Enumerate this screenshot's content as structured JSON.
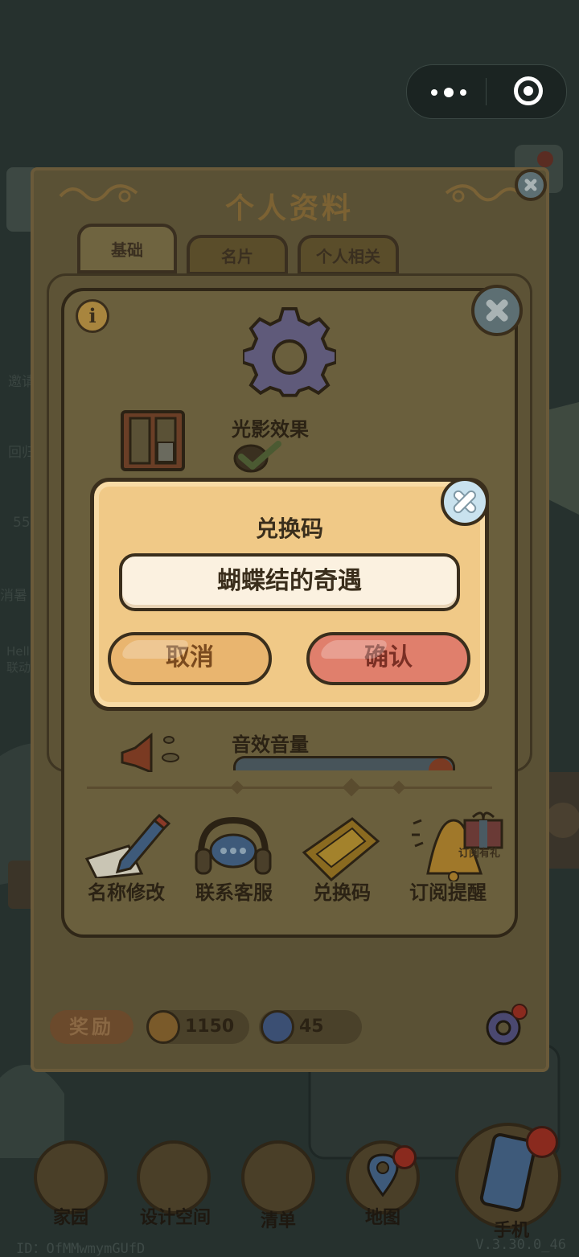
{
  "capsule": {
    "more": "more-icon",
    "close": "target-icon"
  },
  "profile_panel": {
    "title": "个人资料",
    "tabs": [
      {
        "label": "基础",
        "active": true
      },
      {
        "label": "名片",
        "active": false
      },
      {
        "label": "个人相关",
        "active": false
      }
    ]
  },
  "settings": {
    "light_effect_label": "光影效果",
    "light_effect_enabled": true,
    "sound_volume_label": "音效音量"
  },
  "redeem_dialog": {
    "title": "兑换码",
    "input_value": "蝴蝶结的奇遇",
    "cancel_label": "取消",
    "confirm_label": "确认"
  },
  "menu_items": [
    {
      "label": "名称修改",
      "icon": "pencil-icon"
    },
    {
      "label": "联系客服",
      "icon": "headset-icon"
    },
    {
      "label": "兑换码",
      "icon": "ticket-icon"
    },
    {
      "label": "订阅提醒",
      "icon": "bell-icon",
      "badge": "订阅有礼"
    }
  ],
  "rewards": {
    "label": "奖励",
    "coins": "1150",
    "gems": "45"
  },
  "bottom_nav": [
    {
      "label": "家园"
    },
    {
      "label": "设计空间"
    },
    {
      "label": "清单"
    },
    {
      "label": "地图"
    },
    {
      "label": "手机"
    }
  ],
  "footer": {
    "user_id": "ID：OfMMwmymGUfD",
    "version": "V.3.30.0_46"
  },
  "colors": {
    "modal_bg": "#f0c987",
    "cancel_btn": "#e9b56f",
    "confirm_btn": "#e07f6c",
    "overlay": "#26312e"
  }
}
